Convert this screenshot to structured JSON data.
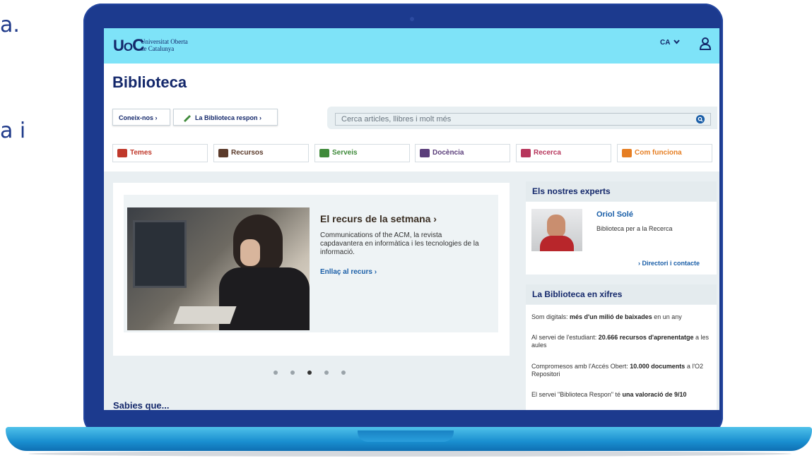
{
  "side_text": [
    "a.",
    "a i"
  ],
  "header": {
    "logo_mark": "UOC",
    "logo_line1": "Universitat Oberta",
    "logo_line2": "de Catalunya",
    "lang": "CA"
  },
  "page_title": "Biblioteca",
  "quick_links": {
    "coneix": "Coneix-nos ›",
    "respon": "La Biblioteca respon ›"
  },
  "search": {
    "placeholder": "Cerca articles, llibres i molt més"
  },
  "nav": [
    {
      "label": "Temes",
      "color": "#c0392b"
    },
    {
      "label": "Recursos",
      "color": "#5b3a2a"
    },
    {
      "label": "Serveis",
      "color": "#3f8a3a"
    },
    {
      "label": "Docència",
      "color": "#5a3d7a"
    },
    {
      "label": "Recerca",
      "color": "#b7365c"
    },
    {
      "label": "Com funciona",
      "color": "#e67e22"
    }
  ],
  "slide": {
    "title": "El recurs de la setmana ›",
    "description": "Communications of the ACM, la revista capdavantera en informàtica i les tecnologies de la informació.",
    "link": "Enllaç al recurs ›",
    "active_dot": 3,
    "dot_count": 5
  },
  "sabies": "Sabies que...",
  "experts": {
    "heading": "Els nostres experts",
    "name": "Oriol Solé",
    "role": "Biblioteca per a la Recerca",
    "link": "› Directori i contacte"
  },
  "figures": {
    "heading": "La Biblioteca en xifres",
    "items": [
      {
        "pre": "Som digitals: ",
        "bold": "més d'un milió de baixades",
        "post": " en un any"
      },
      {
        "pre": "Al servei de l'estudiant: ",
        "bold": "20.666 recursos d'aprenentatge",
        "post": " a les aules"
      },
      {
        "pre": "Compromesos amb l'Accés Obert: ",
        "bold": "10.000 documents",
        "post": " a l'O2 Repositori"
      },
      {
        "pre": "El servei \"Biblioteca Respon\" té ",
        "bold": "una valoració de 9/10",
        "post": ""
      }
    ]
  }
}
